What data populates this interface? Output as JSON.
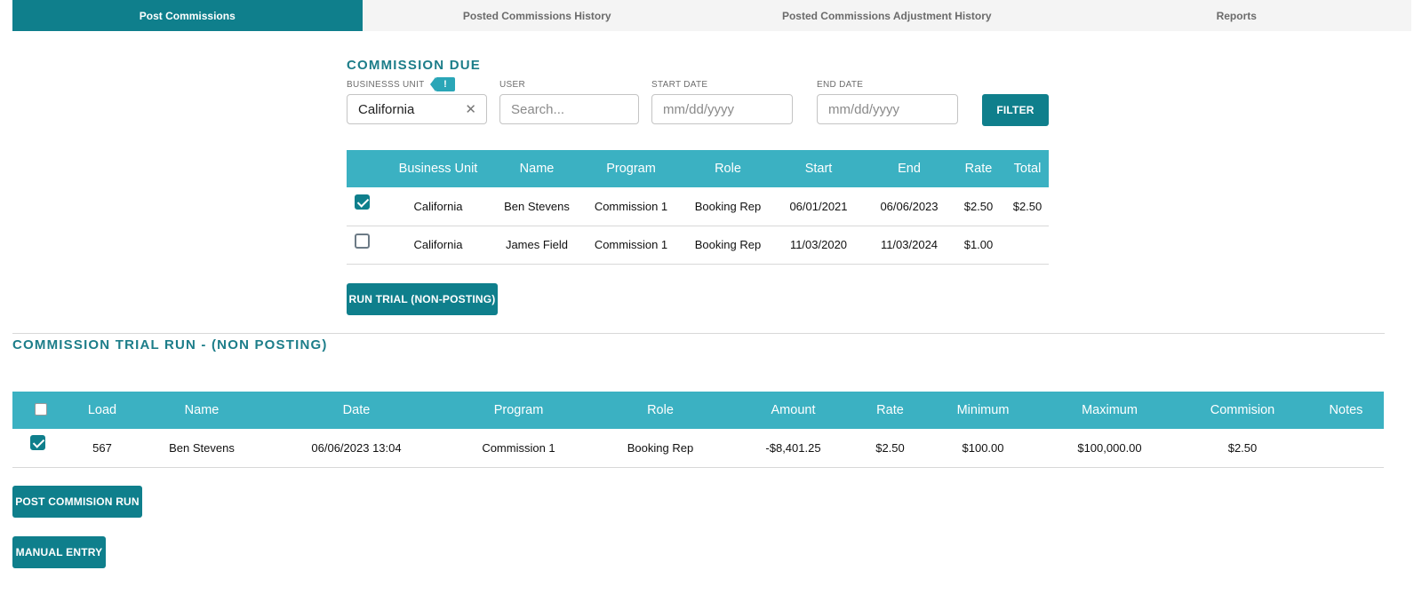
{
  "tabs": [
    {
      "label": "Post Commissions",
      "active": true
    },
    {
      "label": "Posted Commissions History",
      "active": false
    },
    {
      "label": "Posted Commissions Adjustment History",
      "active": false
    },
    {
      "label": "Reports",
      "active": false
    }
  ],
  "commission_due": {
    "title": "COMMISSION DUE",
    "business_unit": {
      "label": "BUSINESSS UNIT",
      "value": "California",
      "badge": "!"
    },
    "user": {
      "label": "USER",
      "placeholder": "Search..."
    },
    "start_date": {
      "label": "START DATE",
      "placeholder": "mm/dd/yyyy"
    },
    "end_date": {
      "label": "END DATE",
      "placeholder": "mm/dd/yyyy"
    },
    "filter_label": "FILTER",
    "columns": [
      "Business Unit",
      "Name",
      "Program",
      "Role",
      "Start",
      "End",
      "Rate",
      "Total"
    ],
    "rows": [
      {
        "checked": true,
        "cells": [
          "California",
          "Ben Stevens",
          "Commission 1",
          "Booking Rep",
          "06/01/2021",
          "06/06/2023",
          "$2.50",
          "$2.50"
        ]
      },
      {
        "checked": false,
        "cells": [
          "California",
          "James Field",
          "Commission 1",
          "Booking Rep",
          "11/03/2020",
          "11/03/2024",
          "$1.00",
          ""
        ]
      }
    ],
    "run_trial_label": "RUN TRIAL (NON-POSTING)"
  },
  "trial_run": {
    "title": "COMMISSION TRIAL RUN - (NON POSTING)",
    "columns": [
      "Load",
      "Name",
      "Date",
      "Program",
      "Role",
      "Amount",
      "Rate",
      "Minimum",
      "Maximum",
      "Commision",
      "Notes"
    ],
    "rows": [
      {
        "checked": true,
        "cells": [
          "567",
          "Ben Stevens",
          "06/06/2023 13:04",
          "Commission 1",
          "Booking Rep",
          "-$8,401.25",
          "$2.50",
          "$100.00",
          "$100,000.00",
          "$2.50",
          ""
        ]
      }
    ],
    "post_label": "POST COMMISION RUN",
    "manual_label": "MANUAL ENTRY"
  },
  "colors": {
    "primary": "#0f7f8c",
    "header": "#3bb1c2",
    "title": "#1c7d89"
  }
}
